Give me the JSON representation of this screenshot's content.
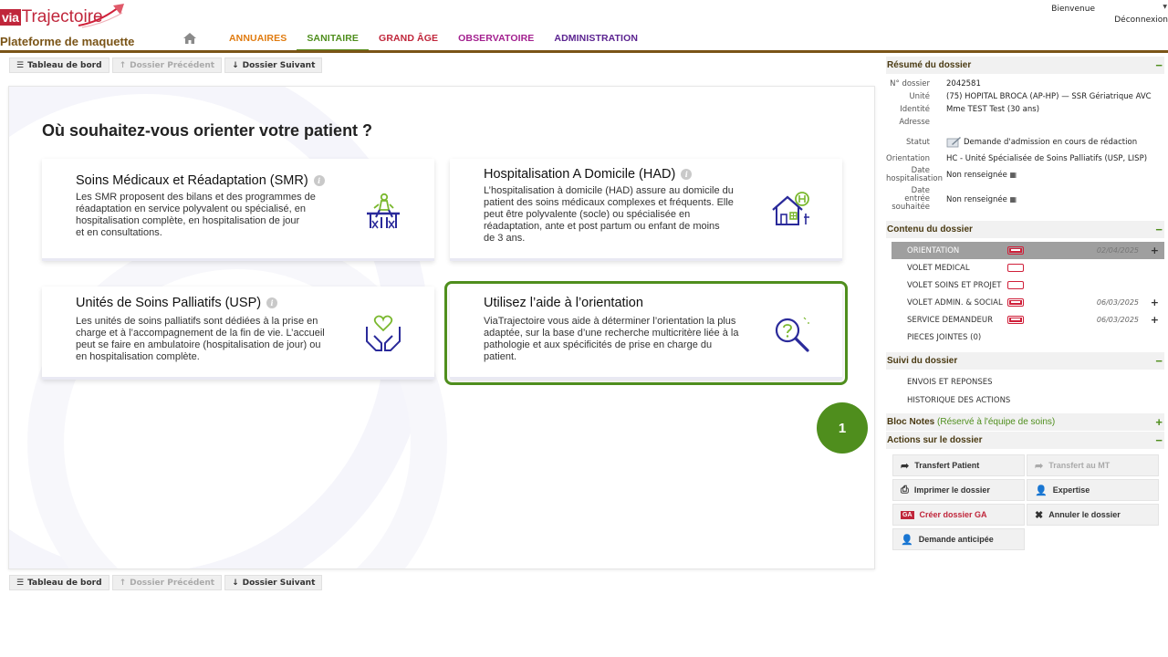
{
  "header": {
    "logo_via": "via",
    "logo_rest": "Trajectoire",
    "platform": "Plateforme de maquette",
    "welcome": "Bienvenue",
    "logout": "Déconnexion",
    "nav": [
      {
        "label": "ANNUAIRES",
        "color": "#e07b0f"
      },
      {
        "label": "SANITAIRE",
        "color": "#4f8e1d"
      },
      {
        "label": "GRAND ÂGE",
        "color": "#c0263b"
      },
      {
        "label": "OBSERVATOIRE",
        "color": "#a3208f"
      },
      {
        "label": "ADMINISTRATION",
        "color": "#5b2390"
      }
    ]
  },
  "toolbar": {
    "dashboard": "Tableau de bord",
    "previous": "Dossier Précédent",
    "next": "Dossier Suivant"
  },
  "main": {
    "title": "Où souhaitez-vous orienter votre patient ?",
    "cards": [
      {
        "title": "Soins Médicaux et Réadaptation (SMR)",
        "desc": [
          "Les SMR proposent des bilans et des programmes de",
          "réadaptation en service polyvalent ou spécialisé, en",
          "hospitalisation complète, en hospitalisation de jour",
          "et en consultations."
        ]
      },
      {
        "title": "Hospitalisation A Domicile (HAD)",
        "desc": [
          "L’hospitalisation à domicile (HAD) assure au domicile du",
          "patient des soins médicaux complexes et fréquents. Elle",
          "peut être polyvalente (socle) ou spécialisée en",
          "réadaptation, ante et post partum ou enfant de moins",
          "de 3 ans."
        ]
      },
      {
        "title": "Unités de Soins Palliatifs (USP)",
        "desc": [
          "Les unités de soins palliatifs sont dédiées à la prise en",
          "charge et à l’accompagnement de la fin de vie. L’accueil",
          "peut se faire en ambulatoire (hospitalisation de jour) ou",
          "en hospitalisation complète."
        ]
      },
      {
        "title": "Utilisez l’aide à l’orientation",
        "desc": [
          "ViaTrajectoire vous aide à déterminer l’orientation la plus",
          "adaptée, sur la base d’une recherche multicritère liée à la",
          "pathologie et aux spécificités de prise en charge du",
          "patient."
        ]
      }
    ],
    "step": "1"
  },
  "summary": {
    "title": "Résumé du dossier",
    "rows": [
      {
        "label": "N° dossier",
        "value": "2042581"
      },
      {
        "label": "Unité",
        "value": "(75) HOPITAL BROCA (AP-HP) — SSR Gériatrique AVC"
      },
      {
        "label": "Identité",
        "value": "Mme TEST Test (30 ans)"
      },
      {
        "label": "Adresse",
        "value": ""
      },
      {
        "label": "Statut",
        "value": "Demande d'admission en cours de rédaction"
      },
      {
        "label": "Orientation",
        "value": "HC - Unité Spécialisée de Soins Palliatifs (USP, LISP)"
      },
      {
        "label": "Date hospitalisation",
        "value": "Non renseignée"
      },
      {
        "label": "Date entrée souhaitée",
        "value": "Non renseignée"
      }
    ]
  },
  "contents": {
    "title": "Contenu du dossier",
    "items": [
      {
        "label": "ORIENTATION",
        "date": "02/04/2025",
        "plus": "+",
        "battery": "full"
      },
      {
        "label": "VOLET MEDICAL",
        "date": "",
        "plus": "",
        "battery": "empty"
      },
      {
        "label": "VOLET SOINS ET PROJET",
        "date": "",
        "plus": "",
        "battery": "empty"
      },
      {
        "label": "VOLET ADMIN. & SOCIAL",
        "date": "06/03/2025",
        "plus": "+",
        "battery": "full"
      },
      {
        "label": "SERVICE DEMANDEUR",
        "date": "06/03/2025",
        "plus": "+",
        "battery": "full"
      }
    ],
    "attachments": "PIECES JOINTES (0)"
  },
  "followup": {
    "title": "Suivi du dossier",
    "items": [
      "ENVOIS ET REPONSES",
      "HISTORIQUE DES ACTIONS"
    ]
  },
  "notes": {
    "title": "Bloc Notes",
    "subtitle": "(Réservé à l'équipe de soins)"
  },
  "actions": {
    "title": "Actions sur le dossier",
    "transfer_patient": "Transfert Patient",
    "transfer_mt": "Transfert au MT",
    "print": "Imprimer le dossier",
    "expertise": "Expertise",
    "create_ga": "Créer dossier GA",
    "cancel": "Annuler le dossier",
    "anticipated": "Demande anticipée"
  }
}
